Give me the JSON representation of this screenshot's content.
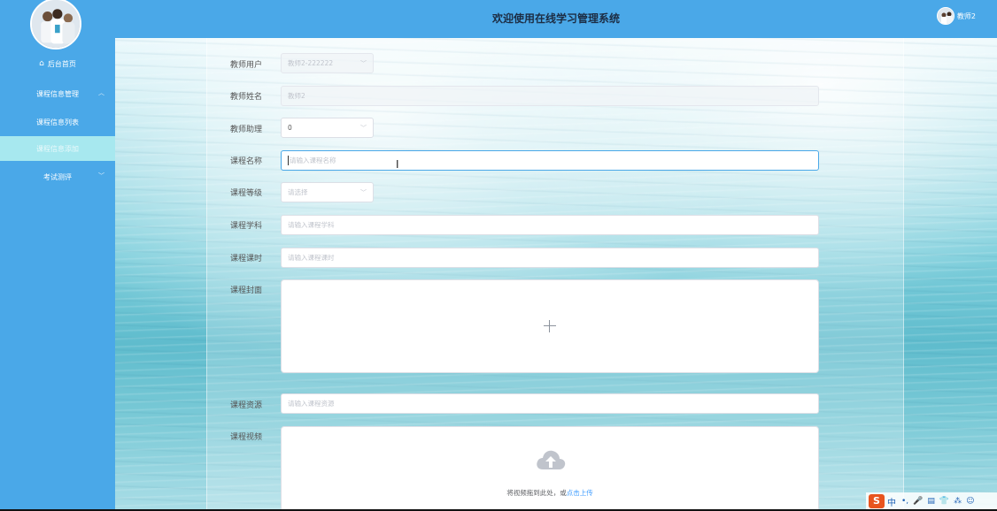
{
  "header": {
    "title": "欢迎使用在线学习管理系统",
    "user_name": "教师2"
  },
  "sidebar": {
    "items": [
      {
        "label": "后台首页",
        "icon": "home-icon"
      },
      {
        "label": "课程信息管理",
        "icon": "chevron-up-icon"
      },
      {
        "label": "课程信息列表"
      },
      {
        "label": "课程信息添加",
        "active": true
      },
      {
        "label": "考试测评",
        "icon": "chevron-down-icon"
      }
    ]
  },
  "form": {
    "teacher_user": {
      "label": "教师用户",
      "value": "教师2-222222"
    },
    "teacher_name": {
      "label": "教师姓名",
      "value": "教师2"
    },
    "teacher_assistant": {
      "label": "教师助理",
      "value": "0"
    },
    "course_name": {
      "label": "课程名称",
      "placeholder": "请输入课程名称"
    },
    "course_level": {
      "label": "课程等级",
      "placeholder": "请选择"
    },
    "course_subject": {
      "label": "课程学科",
      "placeholder": "请输入课程学科"
    },
    "course_hours": {
      "label": "课程课时",
      "placeholder": "请输入课程课时"
    },
    "course_cover": {
      "label": "课程封面"
    },
    "course_resource": {
      "label": "课程资源",
      "placeholder": "请输入课程资源"
    },
    "course_video": {
      "label": "课程视频",
      "drop_text": "将视频拖到此处，或",
      "click_text": "点击上传"
    }
  },
  "ime": {
    "logo": "S",
    "mode": "中",
    "icons": [
      "•,",
      "🎤",
      "▤",
      "👕",
      "⁂",
      "☺"
    ]
  },
  "colors": {
    "sidebar_bg": "#4aa8e8",
    "active_item_bg": "#a7e8ef",
    "link": "#409eff"
  }
}
